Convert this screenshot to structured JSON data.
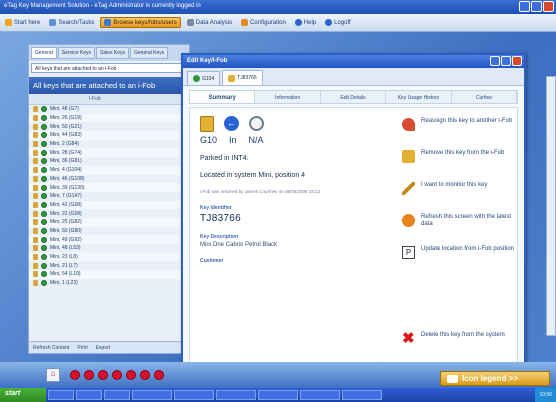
{
  "window": {
    "title": "eTag Key Management Solution - eTag Administrator is currently logged in"
  },
  "menu": [
    {
      "label": "Start here"
    },
    {
      "label": "Search/Tasks"
    },
    {
      "label": "Browse keys/fobs/users"
    },
    {
      "label": "Data Analysis"
    },
    {
      "label": "Configuration"
    },
    {
      "label": "Help"
    },
    {
      "label": "Logoff"
    }
  ],
  "left": {
    "tabs": [
      "General",
      "Service Keys",
      "Sales Keys",
      "General Keys"
    ],
    "select": "All keys that are attached to an i-Fob",
    "heading": "All keys that are attached to an i-Fob",
    "col": "I-Fob",
    "rows": [
      "Mini, 48 (G7)",
      "Mini, 26 (G19)",
      "Mini, 50 (G21)",
      "Mini, 44 (G83)",
      "Mini, 2 (G84)",
      "Mini, 28 (G74)",
      "Mini, 36 (G81)",
      "Mini, 4 (G104)",
      "Mini, 46 (G108)",
      "Mini, 39 (G130)",
      "Mini, 7 (G147)",
      "Mini, 42 (G68)",
      "Mini, 22 (G58)",
      "Mini, 25 (G82)",
      "Mini, 60 (G80)",
      "Mini, 49 (G92)",
      "Mini, 48 (L53)",
      "Mini, 23 (L8)",
      "Mini, 21 (L7)",
      "Mini, 54 (L19)",
      "Mini, 1 (L23)"
    ],
    "footer": [
      "Refresh Content",
      "Print",
      "Export"
    ]
  },
  "dialog": {
    "title": "Edit Key/I-Fob",
    "keytabs": [
      "G104",
      "TJ83766"
    ],
    "subtabs": [
      "Summary",
      "Information",
      "Edit Details",
      "Key Usage History",
      "Curfew"
    ],
    "status": [
      "G10",
      "In",
      "N/A"
    ],
    "parked": "Parked in INT4.",
    "located": "Located in system Mini, position 4",
    "returned": "i-Fob was returned by James Courtney on 06/06/2008 18:12",
    "key_identifier_label": "Key Identifier",
    "key_identifier": "TJ83766",
    "key_description_label": "Key Description",
    "key_description": "Mini One Cabrio Petrol Black",
    "customer_label": "Customer",
    "actions": [
      "Reassign this key to another i-Fob",
      "Remove this key from the i-Fob",
      "I want to monitor this key",
      "Refresh this screen with the latest data",
      "Update location from i-Fob position"
    ],
    "delete": "Delete this key from the system"
  },
  "bottom": {
    "legend": "Icon legend >>"
  },
  "taskbar": {
    "start": "start",
    "clock": "10:56"
  }
}
